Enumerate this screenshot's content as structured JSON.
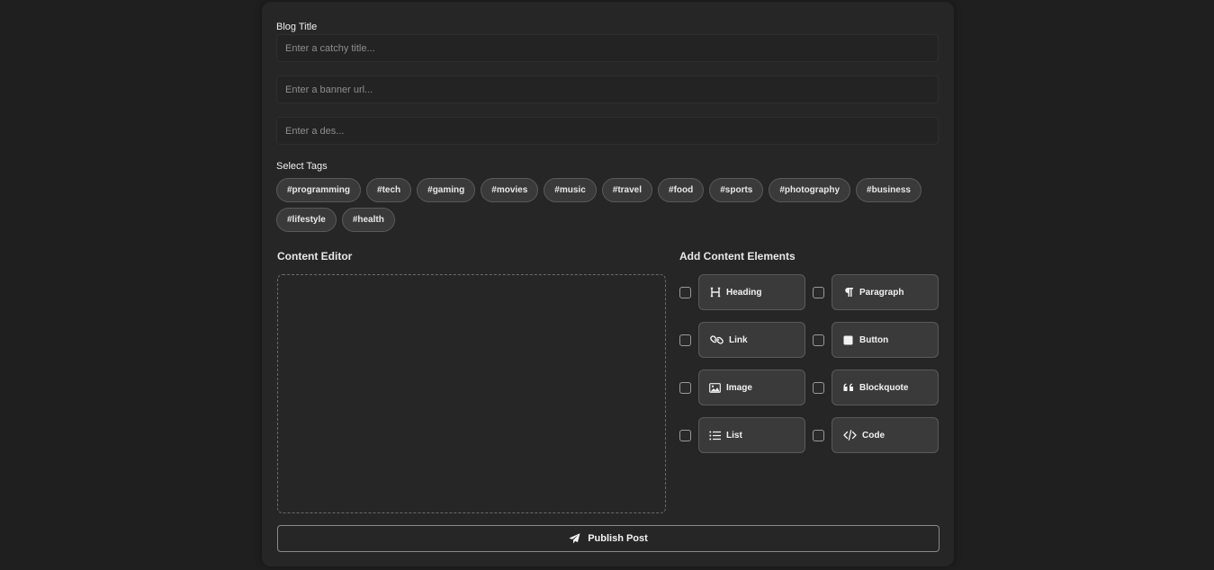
{
  "form": {
    "title_label": "Blog Title",
    "title_placeholder": "Enter a catchy title...",
    "banner_placeholder": "Enter a banner url...",
    "description_placeholder": "Enter a des...",
    "tags_label": "Select Tags",
    "tags": [
      "#programming",
      "#tech",
      "#gaming",
      "#movies",
      "#music",
      "#travel",
      "#food",
      "#sports",
      "#photography",
      "#business",
      "#lifestyle",
      "#health"
    ]
  },
  "editor": {
    "title": "Content Editor"
  },
  "elements": {
    "title": "Add Content Elements",
    "items": [
      {
        "label": "Heading",
        "icon": "heading-icon"
      },
      {
        "label": "Paragraph",
        "icon": "paragraph-icon"
      },
      {
        "label": "Link",
        "icon": "link-icon"
      },
      {
        "label": "Button",
        "icon": "button-icon"
      },
      {
        "label": "Image",
        "icon": "image-icon"
      },
      {
        "label": "Blockquote",
        "icon": "quote-icon"
      },
      {
        "label": "List",
        "icon": "list-icon"
      },
      {
        "label": "Code",
        "icon": "code-icon"
      }
    ]
  },
  "publish": {
    "label": "Publish Post",
    "icon": "paper-plane-icon"
  },
  "colors": {
    "page_bg": "#1f1f1f",
    "card_bg": "#262626",
    "tag_bg": "#3a3a3a",
    "border": "#5a5a5a"
  }
}
